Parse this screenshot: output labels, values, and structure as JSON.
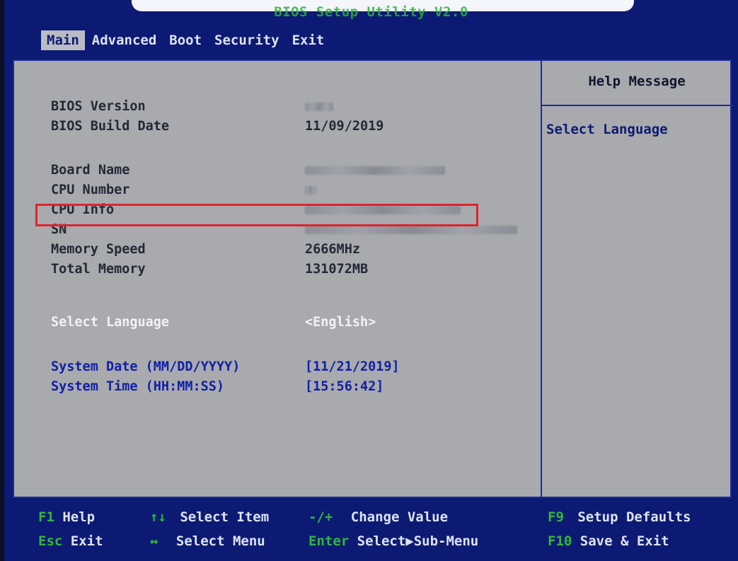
{
  "title": "BIOS Setup Utility V2.0",
  "tabs": [
    "Main",
    "Advanced",
    "Boot",
    "Security",
    "Exit"
  ],
  "active_tab": "Main",
  "help": {
    "header": "Help Message",
    "text": "Select Language"
  },
  "rows": {
    "bios_version": {
      "label": "BIOS Version",
      "value": ""
    },
    "bios_build_date": {
      "label": "BIOS Build Date",
      "value": "11/09/2019"
    },
    "board_name": {
      "label": "Board Name",
      "value": ""
    },
    "cpu_number": {
      "label": "CPU Number",
      "value": ""
    },
    "cpu_info": {
      "label": "CPU Info",
      "value": ""
    },
    "sn": {
      "label": "SN",
      "value": ""
    },
    "memory_speed": {
      "label": "Memory Speed",
      "value": "2666MHz"
    },
    "total_memory": {
      "label": "Total Memory",
      "value": "131072MB"
    },
    "select_language": {
      "label": "Select Language",
      "value": "<English>"
    },
    "system_date": {
      "label": "System Date (MM/DD/YYYY)",
      "value": "[11/21/2019]"
    },
    "system_time": {
      "label": "System Time (HH:MM:SS)",
      "value": "[15:56:42]"
    }
  },
  "footer": {
    "f1_key": "F1",
    "f1_text": "Help",
    "arrows_ud_key": "↑↓",
    "arrows_ud_text": "Select Item",
    "minus_plus_key": "-/+",
    "minus_plus_text": "Change Value",
    "f9_key": "F9",
    "f9_text": "Setup Defaults",
    "esc_key": "Esc",
    "esc_text": "Exit",
    "arrows_lr_key": "↔",
    "arrows_lr_text": "Select Menu",
    "enter_key": "Enter",
    "enter_text": "Select▶Sub-Menu",
    "f10_key": "F10",
    "f10_text": "Save & Exit"
  },
  "colors": {
    "background_blue": "#0c1a73",
    "panel_gray": "#a9aaae",
    "key_green": "#2fb83a",
    "highlight_red": "#e0232d"
  }
}
